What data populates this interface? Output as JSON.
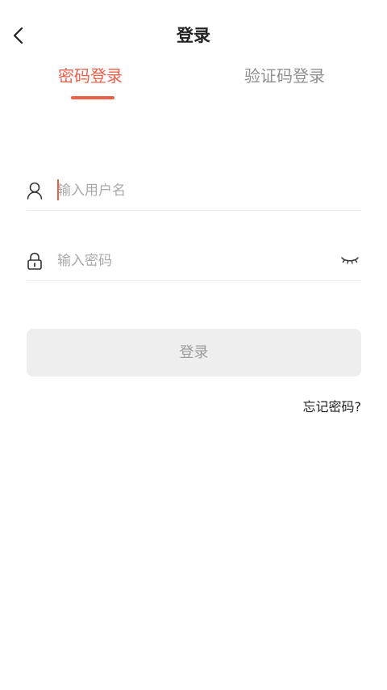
{
  "header": {
    "title": "登录",
    "back_icon": "chevron-left-icon"
  },
  "tabs": [
    {
      "label": "密码登录",
      "active": true
    },
    {
      "label": "验证码登录",
      "active": false
    }
  ],
  "form": {
    "username": {
      "placeholder": "输入用户名",
      "value": "",
      "icon": "user-icon"
    },
    "password": {
      "placeholder": "输入密码",
      "value": "",
      "icon": "lock-icon",
      "toggle_icon": "eye-closed-icon"
    }
  },
  "login_button": {
    "label": "登录"
  },
  "forgot_password": {
    "label": "忘记密码?"
  },
  "colors": {
    "accent": "#ee5f4a",
    "inactive_tab": "#8f8f8f",
    "button_bg": "#eeeeee",
    "button_text": "#9c9c9c",
    "placeholder": "#a9a9a9"
  }
}
